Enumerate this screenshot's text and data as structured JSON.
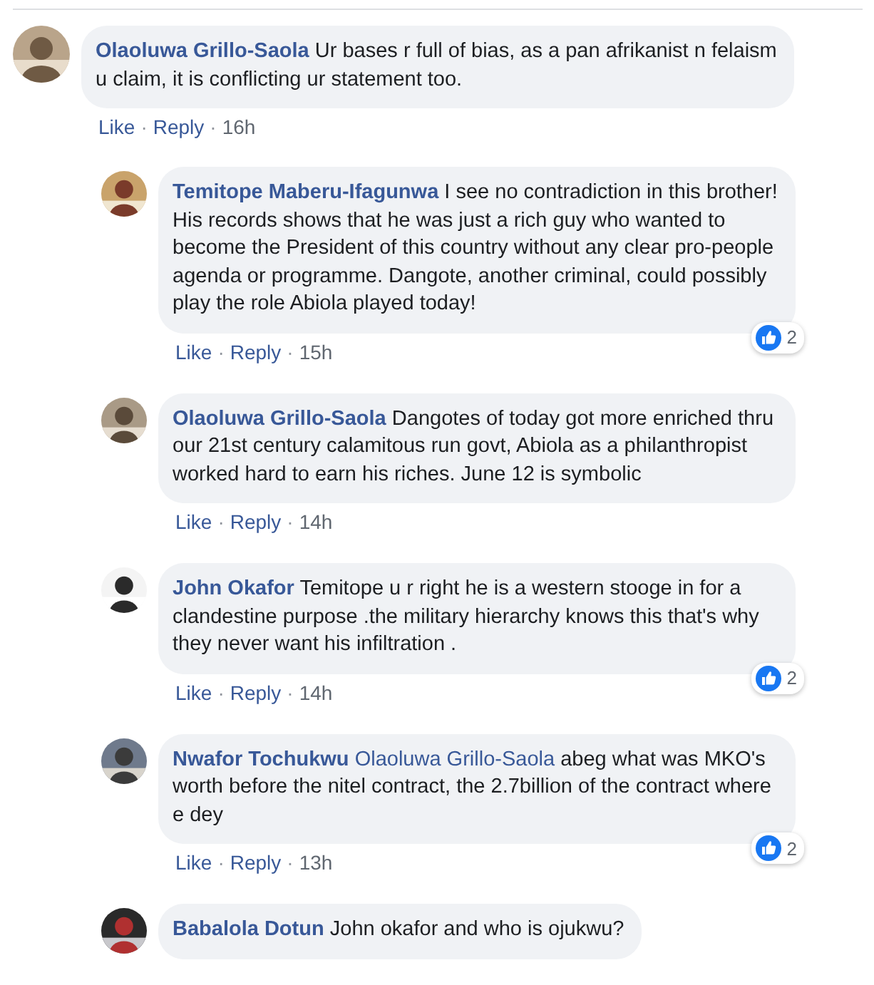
{
  "comments": [
    {
      "author": "Olaoluwa Grillo-Saola",
      "text": "Ur bases r full of bias, as a pan afrikanist n felaism u claim, it is conflicting ur statement too.",
      "meta": [
        {
          "kind": "link",
          "label": "Like"
        },
        {
          "kind": "dot",
          "label": "·"
        },
        {
          "kind": "link",
          "label": "Reply"
        },
        {
          "kind": "dot",
          "label": "·"
        },
        {
          "kind": "time",
          "label": "16h"
        }
      ],
      "replies": [
        {
          "author": "Temitope Maberu-Ifagunwa",
          "text": "I see no contradiction in this brother! His records shows that he was just a rich guy who wanted to become the President of this country without any clear pro-people agenda or programme. Dangote, another criminal, could possibly play the role Abiola played today!",
          "reactions": "2",
          "meta": [
            {
              "kind": "link",
              "label": "Like"
            },
            {
              "kind": "dot",
              "label": "·"
            },
            {
              "kind": "link",
              "label": "Reply"
            },
            {
              "kind": "dot",
              "label": "·"
            },
            {
              "kind": "time",
              "label": "15h"
            }
          ]
        },
        {
          "author": "Olaoluwa Grillo-Saola",
          "text": "Dangotes of today got more enriched thru our 21st century calamitous run govt, Abiola as a philanthropist worked hard to earn his riches. June 12 is symbolic",
          "meta": [
            {
              "kind": "link",
              "label": "Like"
            },
            {
              "kind": "dot",
              "label": "·"
            },
            {
              "kind": "link",
              "label": "Reply"
            },
            {
              "kind": "dot",
              "label": "·"
            },
            {
              "kind": "time",
              "label": "14h"
            }
          ]
        },
        {
          "author": "John Okafor",
          "text": "Temitope u r right he is a western stooge in for a clandestine purpose .the military hierarchy knows this that's why they never want his infiltration .",
          "reactions": "2",
          "meta": [
            {
              "kind": "link",
              "label": "Like"
            },
            {
              "kind": "dot",
              "label": "·"
            },
            {
              "kind": "link",
              "label": "Reply"
            },
            {
              "kind": "dot",
              "label": "·"
            },
            {
              "kind": "time",
              "label": "14h"
            }
          ]
        },
        {
          "author": "Nwafor Tochukwu",
          "mention": "Olaoluwa Grillo-Saola",
          "text": "abeg what was MKO's worth before the nitel contract, the 2.7billion of the contract where e dey",
          "reactions": "2",
          "meta": [
            {
              "kind": "link",
              "label": "Like"
            },
            {
              "kind": "dot",
              "label": "·"
            },
            {
              "kind": "link",
              "label": "Reply"
            },
            {
              "kind": "dot",
              "label": "·"
            },
            {
              "kind": "time",
              "label": "13h"
            }
          ]
        },
        {
          "author": "Babalola Dotun",
          "text": "John okafor and who is ojukwu?"
        }
      ]
    }
  ]
}
